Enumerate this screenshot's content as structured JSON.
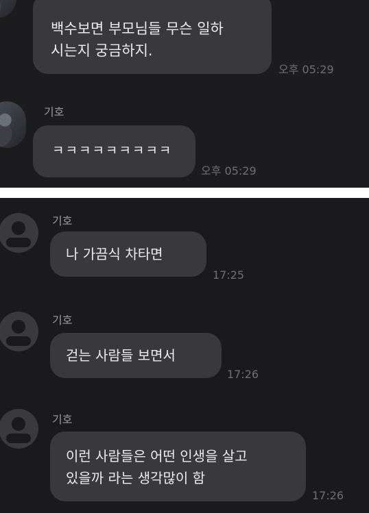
{
  "top_screenshot": {
    "messages": [
      {
        "sender": "",
        "lines": [
          "백수보면 부모님들 무슨 일하",
          "시는지 궁금하지."
        ],
        "time": "오후 05:29"
      },
      {
        "sender": "기호",
        "lines": [
          "ㅋㅋㅋㅋㅋㅋㅋㅋㅋ"
        ],
        "time": "오후 05:29"
      }
    ]
  },
  "bottom_screenshot": {
    "messages": [
      {
        "sender": "기호",
        "lines": [
          "나 가끔식 차타면"
        ],
        "time": "17:25"
      },
      {
        "sender": "기호",
        "lines": [
          "걷는 사람들 보면서"
        ],
        "time": "17:26"
      },
      {
        "sender": "기호",
        "lines": [
          "이런 사람들은 어떤 인생을 살고",
          "있을까 라는 생각많이 함"
        ],
        "time": "17:26"
      }
    ]
  },
  "colors": {
    "background": "#1c1c1e",
    "bubble": "#39393c",
    "text": "#ececef",
    "name": "#9a9aa0",
    "time": "#6f6f74",
    "separator": "#ffffff"
  }
}
